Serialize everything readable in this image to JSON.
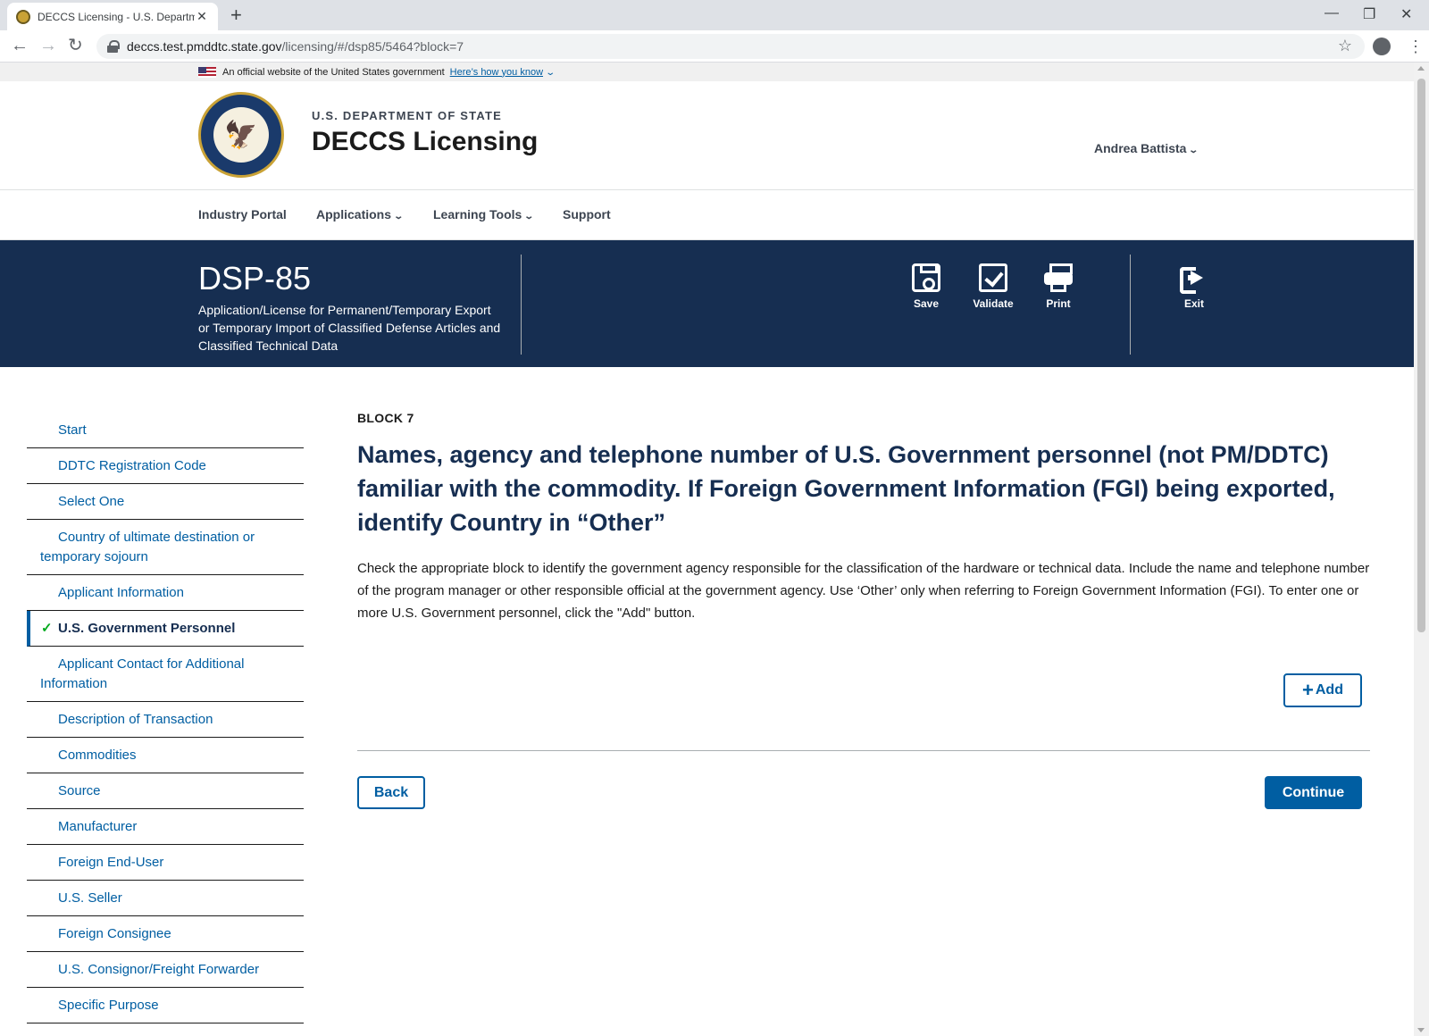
{
  "browser": {
    "tab_title": "DECCS Licensing - U.S. Departme",
    "url_host": "deccs.test.pmddtc.state.gov",
    "url_path": "/licensing/#/dsp85/5464?block=7"
  },
  "gov_banner": {
    "text": "An official website of the United States government",
    "link": "Here’s how you know"
  },
  "header": {
    "department": "U.S. DEPARTMENT OF STATE",
    "site_title": "DECCS Licensing",
    "user_name": "Andrea Battista"
  },
  "nav": {
    "items": [
      "Industry Portal",
      "Applications",
      "Learning Tools",
      "Support"
    ]
  },
  "form": {
    "code": "DSP-85",
    "description": "Application/License for Permanent/Temporary Export or Temporary Import of Classified Defense Articles and Classified Technical Data",
    "actions": {
      "save": "Save",
      "validate": "Validate",
      "print": "Print",
      "exit": "Exit"
    }
  },
  "sidenav": {
    "items": [
      "Start",
      "DDTC Registration Code",
      "Select One",
      "Country of ultimate destination or temporary sojourn",
      "Applicant Information",
      "U.S. Government Personnel",
      "Applicant Contact for Additional Information",
      "Description of Transaction",
      "Commodities",
      "Source",
      "Manufacturer",
      "Foreign End-User",
      "U.S. Seller",
      "Foreign Consignee",
      "U.S. Consignor/Freight Forwarder",
      "Specific Purpose"
    ],
    "current_index": 5
  },
  "block": {
    "label": "BLOCK 7",
    "title": "Names, agency and telephone number of U.S. Government personnel (not PM/DDTC) familiar with the commodity. If Foreign Government Information (FGI) being exported, identify Country in “Other”",
    "description": "Check the appropriate block to identify the government agency responsible for the classification of the hardware or technical data. Include the name and telephone number of the program manager or other responsible official at the government agency. Use ‘Other’ only when referring to Foreign Government Information (FGI). To enter one or more U.S. Government personnel, click the \"Add\" button.",
    "add_label": "Add",
    "back_label": "Back",
    "continue_label": "Continue"
  },
  "colors": {
    "primary": "#005ea2",
    "banner": "#162e51",
    "check": "#00a91c"
  }
}
